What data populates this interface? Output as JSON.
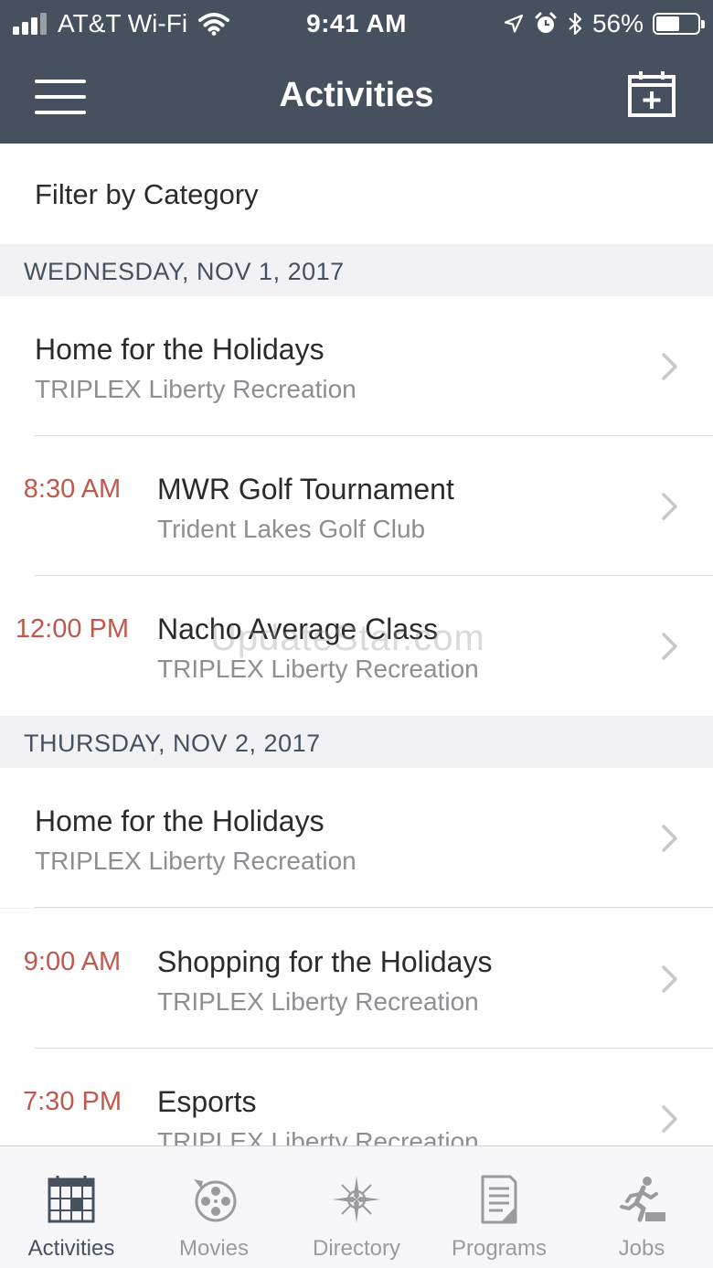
{
  "status_bar": {
    "carrier": "AT&T Wi-Fi",
    "time": "9:41 AM",
    "battery": "56%",
    "battery_level": 0.56
  },
  "header": {
    "title": "Activities"
  },
  "filter": {
    "label": "Filter by Category"
  },
  "sections": [
    {
      "date": "WEDNESDAY, NOV 1, 2017",
      "events": [
        {
          "time": "",
          "title": "Home for the Holidays",
          "location": "TRIPLEX Liberty Recreation"
        },
        {
          "time": "8:30 AM",
          "title": "MWR Golf Tournament",
          "location": "Trident Lakes Golf Club"
        },
        {
          "time": "12:00 PM",
          "title": "Nacho Average Class",
          "location": "TRIPLEX Liberty Recreation"
        }
      ]
    },
    {
      "date": "THURSDAY, NOV 2, 2017",
      "events": [
        {
          "time": "",
          "title": "Home for the Holidays",
          "location": "TRIPLEX Liberty Recreation"
        },
        {
          "time": "9:00 AM",
          "title": "Shopping for the Holidays",
          "location": "TRIPLEX Liberty Recreation"
        },
        {
          "time": "7:30 PM",
          "title": "Esports",
          "location": "TRIPLEX Liberty Recreation"
        }
      ]
    }
  ],
  "watermark": "UpdateStar.com",
  "tabs": [
    {
      "label": "Activities",
      "icon": "calendar-grid-icon"
    },
    {
      "label": "Movies",
      "icon": "film-reel-icon"
    },
    {
      "label": "Directory",
      "icon": "compass-icon"
    },
    {
      "label": "Programs",
      "icon": "document-icon"
    },
    {
      "label": "Jobs",
      "icon": "running-person-icon"
    }
  ],
  "colors": {
    "header_bg": "#46505e",
    "time_accent": "#c0594b",
    "subtitle": "#8e8e93",
    "tab_inactive": "#9a9a9f"
  }
}
